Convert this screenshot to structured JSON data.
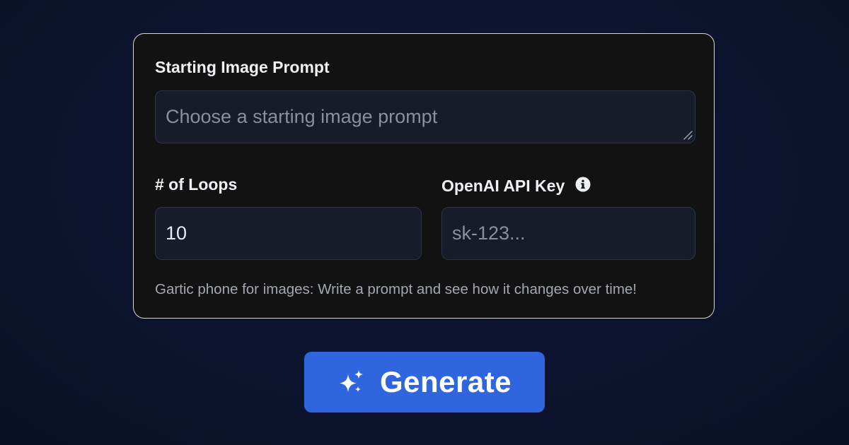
{
  "form": {
    "prompt_label": "Starting Image Prompt",
    "prompt_placeholder": "Choose a starting image prompt",
    "prompt_value": "",
    "loops_label": "# of Loops",
    "loops_value": "10",
    "api_key_label": "OpenAI API Key",
    "api_key_info_icon": "info-circle-icon",
    "api_key_placeholder": "sk-123...",
    "api_key_value": "",
    "helper_text": "Gartic phone for images: Write a prompt and see how it changes over time!"
  },
  "generate_button": {
    "label": "Generate",
    "icon": "sparkles-icon"
  },
  "colors": {
    "background": "#0d1430",
    "card_background": "#121212",
    "card_border": "#d6d6d6",
    "input_background": "#161c2a",
    "input_border": "#2d3444",
    "label_text": "#eef0f4",
    "helper_text": "#a3a7b1",
    "button_background": "#2f66e0",
    "button_text": "#ffffff"
  }
}
